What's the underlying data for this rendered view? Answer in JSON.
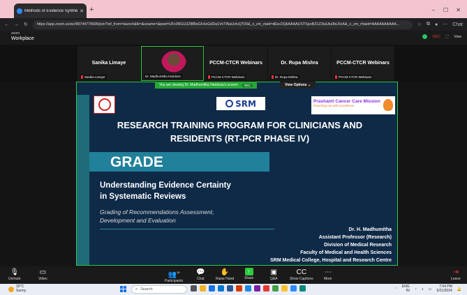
{
  "browser": {
    "tab_title": "Methods of Evidence Synthe...",
    "url": "https://app.zoom.us/wc/89744779696/join?ref_from=launch&tk=&uname=&pwd=UFc0RGU2ZlBBeGhXeGdDa1VoTlNaUzlvQT09&_x_zm_rtaid=dEw.DQkAAAAUSTSpoBZ1Z2taUtu0bLRzA&_x_zm_rhtaid=AAAAAAAAAA...",
    "new_tab": "+",
    "icons": [
      "back-icon",
      "reload-icon",
      "star-icon",
      "extension-icon",
      "profile-icon",
      "chat-icon"
    ],
    "chat_label": "Chat"
  },
  "zoom": {
    "logo_top": "zoom",
    "logo_bottom": "Workplace",
    "rec_label": "REC",
    "view_label": "View"
  },
  "participants": [
    {
      "name_center": "Sanika Limaye",
      "label": "Sanika Limaye"
    },
    {
      "name_center": "",
      "label": "Dr. Madhumitha Haridoss"
    },
    {
      "name_center": "PCCM-CTCR Webinars",
      "label": "PCCM-CTCR Webinars"
    },
    {
      "name_center": "Dr. Rupa Mishra",
      "label": "Dr. Rupa Mishra"
    },
    {
      "name_center": "PCCM-CTCR Webinars",
      "label": "PCCM-CTCR Webinars"
    }
  ],
  "share_banner": {
    "text": "You are viewing  Dr. Madhumitha Haridoss's screen",
    "badge": "REC",
    "view_options": "View Options"
  },
  "slide": {
    "logo_center": "SRM",
    "logo_right_title": "Prashanti Cancer Care Mission",
    "logo_right_tagline": "Reaching out with excellence",
    "title_line1": "RESEARCH TRAINING PROGRAM FOR CLINICIANS AND",
    "title_line2": "RESIDENTS (RT-PCR PHASE IV)",
    "grade": "GRADE",
    "subtitle_line1": "Understanding Evidence Certainty",
    "subtitle_line2": "in Systematic Reviews",
    "italic_line1": "Grading of Recommendations Assessment,",
    "italic_line2": "Development and Evaluation",
    "author": [
      "Dr. H. Madhumitha",
      "Assistant Professor (Research)",
      "Division of Medical Research",
      "Faculty of Medical and Health Sciences",
      "SRM Medical College, Hospital and Research Centre"
    ]
  },
  "toolbar": {
    "unmute": "Unmute",
    "video": "Video",
    "participants": "Participants",
    "participants_count": "10",
    "chat": "Chat",
    "raise_hand": "Raise Hand",
    "share": "Share",
    "qa": "Q&A",
    "show_captions": "Show Captions",
    "more": "More",
    "leave": "Leave"
  },
  "taskbar": {
    "temp": "32°C",
    "weather": "Sunny",
    "search_placeholder": "Search",
    "lang_top": "ENG",
    "lang_bottom": "IN",
    "time": "7:04 PM",
    "date": "5/21/2024"
  }
}
